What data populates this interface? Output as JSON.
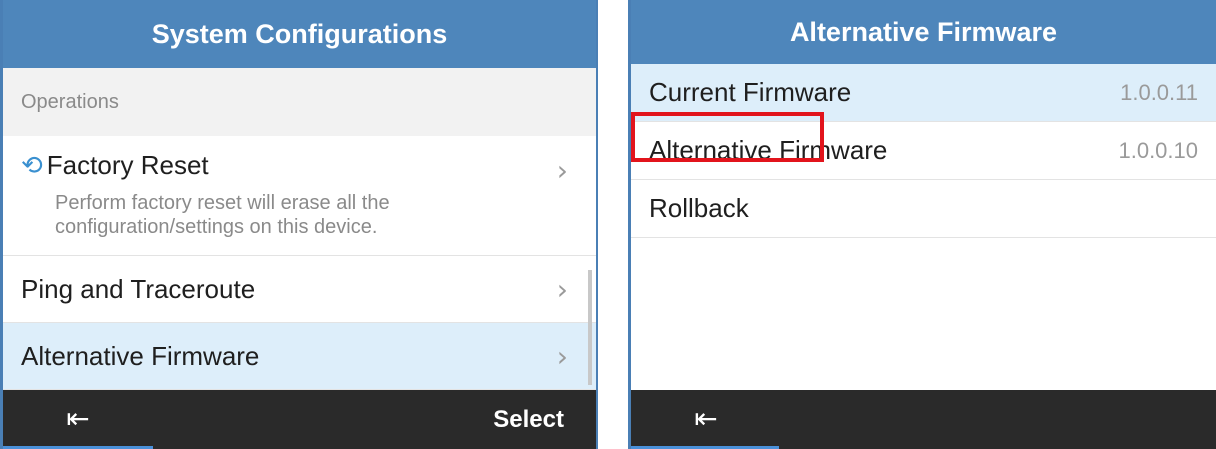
{
  "left": {
    "header_title": "System Configurations",
    "section_label": "Operations",
    "factory_reset": {
      "label": "Factory Reset",
      "description": "Perform factory reset will erase all the configuration/settings on this device.",
      "icon": "reset-icon"
    },
    "items": [
      {
        "label": "Ping and Traceroute"
      },
      {
        "label": "Alternative Firmware"
      }
    ],
    "chevron": "›",
    "footer": {
      "back_icon": "exit-icon",
      "select_label": "Select"
    }
  },
  "right": {
    "header_title": "Alternative Firmware",
    "items": [
      {
        "label": "Current Firmware",
        "value": "1.0.0.11"
      },
      {
        "label": "Alternative Firmware",
        "value": "1.0.0.10"
      },
      {
        "label": "Rollback",
        "value": ""
      }
    ],
    "footer": {
      "back_icon": "exit-icon"
    }
  },
  "colors": {
    "header": "#4e86bb",
    "highlight": "#ddeefa",
    "footer": "#2a2a2a",
    "annotation": "#e2141c"
  }
}
